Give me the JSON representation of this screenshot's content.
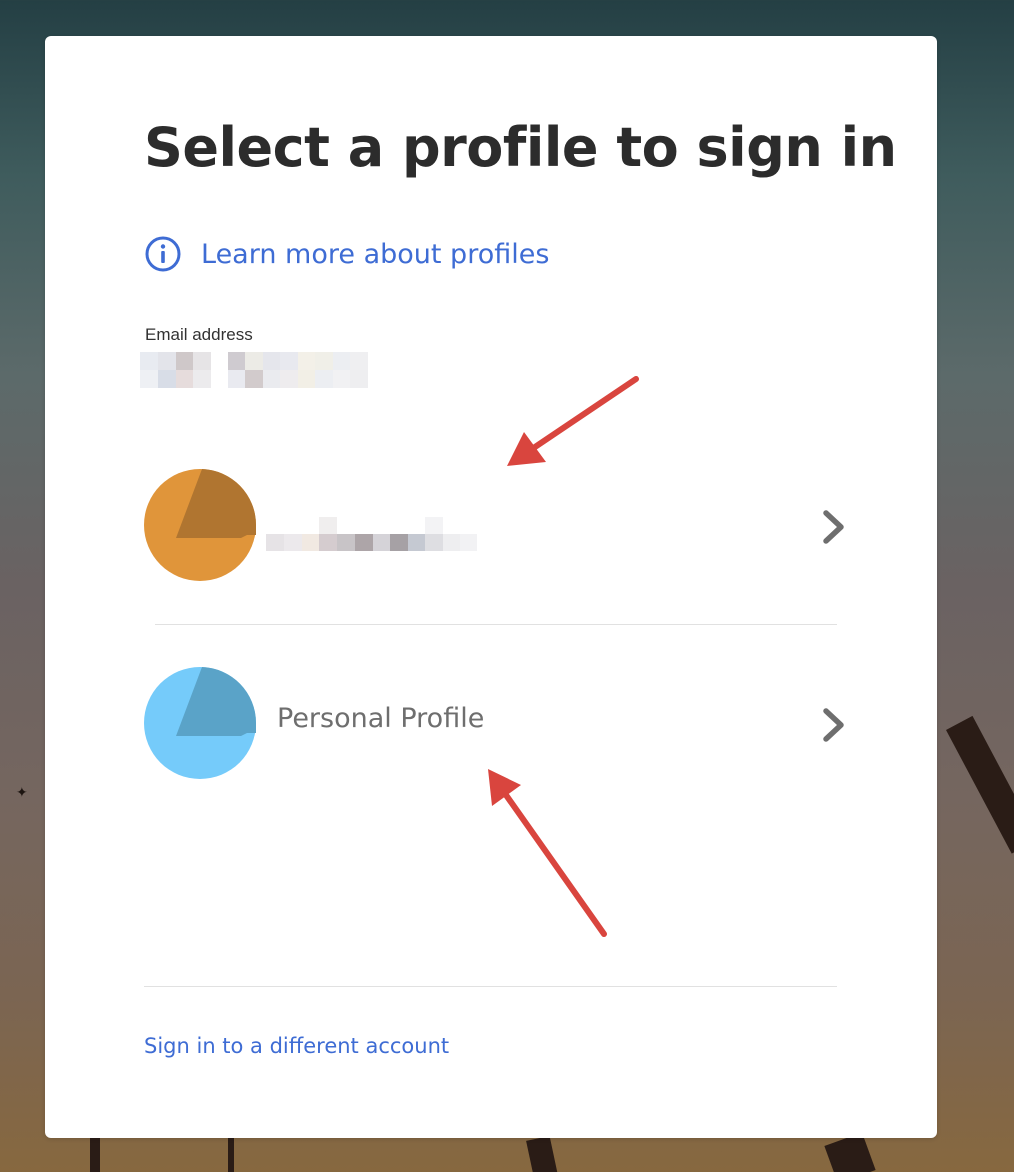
{
  "page": {
    "title": "Select a profile to sign in",
    "learn_more": "Learn more about profiles",
    "email_label": "Email address",
    "email_value": "",
    "profiles": [
      {
        "name": "",
        "avatar_color": "#e0953a",
        "avatar_shade": "#b07530",
        "redacted": true
      },
      {
        "name": "Personal Profile",
        "avatar_color": "#75cbfa",
        "avatar_shade": "#5aa3c8",
        "redacted": false
      }
    ],
    "sign_in_different": "Sign in to a different account"
  },
  "colors": {
    "link": "#3e6cd4",
    "title": "#2c2c2c",
    "annotation_arrow": "#d9453e"
  },
  "icons": {
    "info": "info-circle-icon",
    "chevron": "chevron-right-icon"
  }
}
